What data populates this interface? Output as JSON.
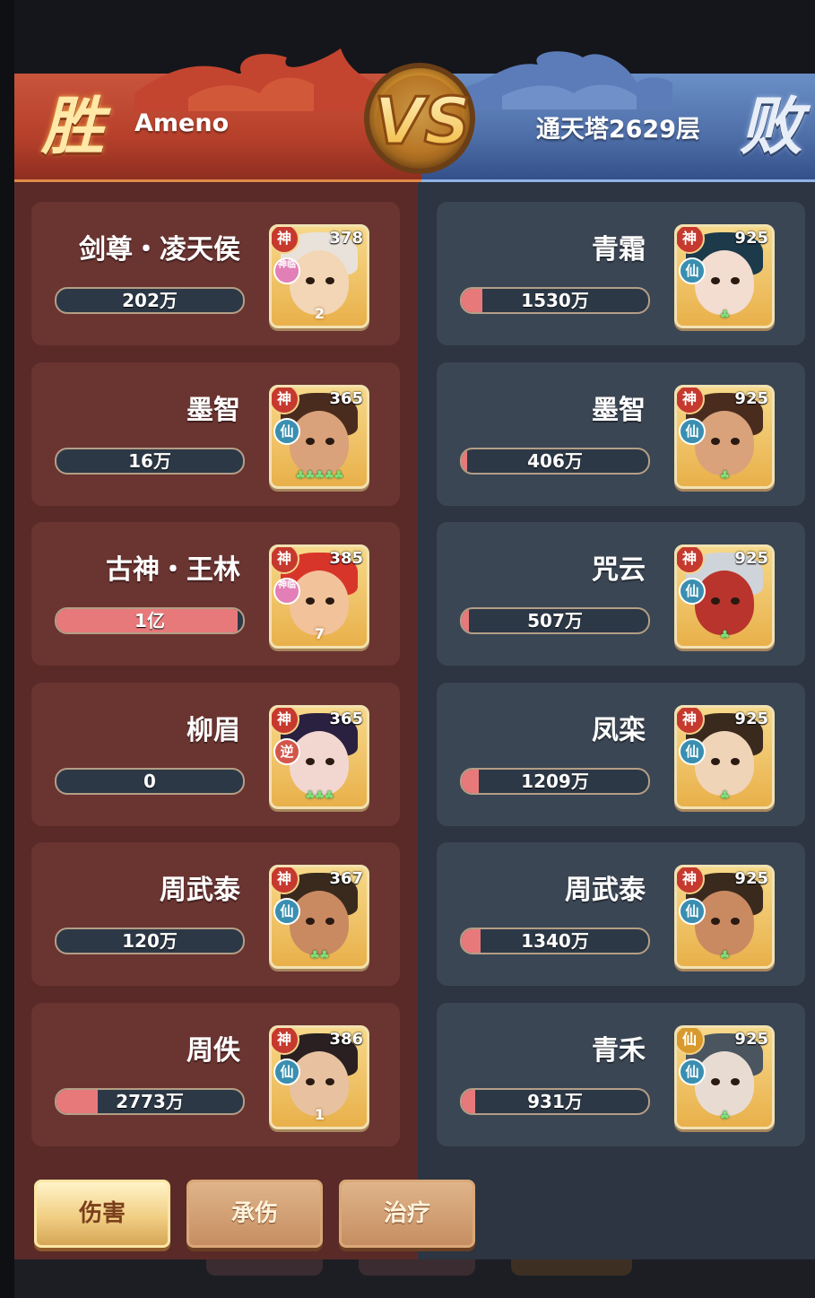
{
  "header": {
    "result_left": "胜",
    "result_right": "败",
    "player_name": "Ameno",
    "opponent_name": "通天塔2629层",
    "vs_label": "VS"
  },
  "left_team": [
    {
      "name": "剑尊・凌天侯",
      "value_label": "202万",
      "fill": 0,
      "level": "378",
      "rank_badge": "神",
      "tier_badge": "神临",
      "stars": "2"
    },
    {
      "name": "墨智",
      "value_label": "16万",
      "fill": 0,
      "level": "365",
      "rank_badge": "神",
      "tier_badge": "仙",
      "stars": "♣♣♣♣♣"
    },
    {
      "name": "古神・王林",
      "value_label": "1亿",
      "fill": 0.97,
      "level": "385",
      "rank_badge": "神",
      "tier_badge": "神临",
      "stars": "7"
    },
    {
      "name": "柳眉",
      "value_label": "0",
      "fill": 0,
      "level": "365",
      "rank_badge": "神",
      "tier_badge": "逆",
      "stars": "♣♣♣"
    },
    {
      "name": "周武泰",
      "value_label": "120万",
      "fill": 0,
      "level": "367",
      "rank_badge": "神",
      "tier_badge": "仙",
      "stars": "♣♣"
    },
    {
      "name": "周佚",
      "value_label": "2773万",
      "fill": 0.22,
      "level": "386",
      "rank_badge": "神",
      "tier_badge": "仙",
      "stars": "1"
    }
  ],
  "right_team": [
    {
      "name": "青霜",
      "value_label": "1530万",
      "fill": 0.11,
      "level": "925",
      "rank_badge": "神",
      "tier_badge": "仙",
      "stars": "♣"
    },
    {
      "name": "墨智",
      "value_label": "406万",
      "fill": 0.03,
      "level": "925",
      "rank_badge": "神",
      "tier_badge": "仙",
      "stars": "♣"
    },
    {
      "name": "咒云",
      "value_label": "507万",
      "fill": 0.04,
      "level": "925",
      "rank_badge": "神",
      "tier_badge": "仙",
      "stars": "♣"
    },
    {
      "name": "凤栾",
      "value_label": "1209万",
      "fill": 0.09,
      "level": "925",
      "rank_badge": "神",
      "tier_badge": "仙",
      "stars": "♣"
    },
    {
      "name": "周武泰",
      "value_label": "1340万",
      "fill": 0.1,
      "level": "925",
      "rank_badge": "神",
      "tier_badge": "仙",
      "stars": "♣"
    },
    {
      "name": "青禾",
      "value_label": "931万",
      "fill": 0.07,
      "level": "925",
      "rank_badge": "仙",
      "tier_badge": "仙",
      "stars": "♣"
    }
  ],
  "tabs": [
    {
      "label": "伤害",
      "active": true
    },
    {
      "label": "承伤",
      "active": false
    },
    {
      "label": "治疗",
      "active": false
    }
  ],
  "colors": {
    "win_red": "#b7402b",
    "lose_blue": "#4e6ea8",
    "bar_fill": "#e8797b",
    "left_panel": "#5a2a28",
    "right_panel": "#2c3541"
  }
}
